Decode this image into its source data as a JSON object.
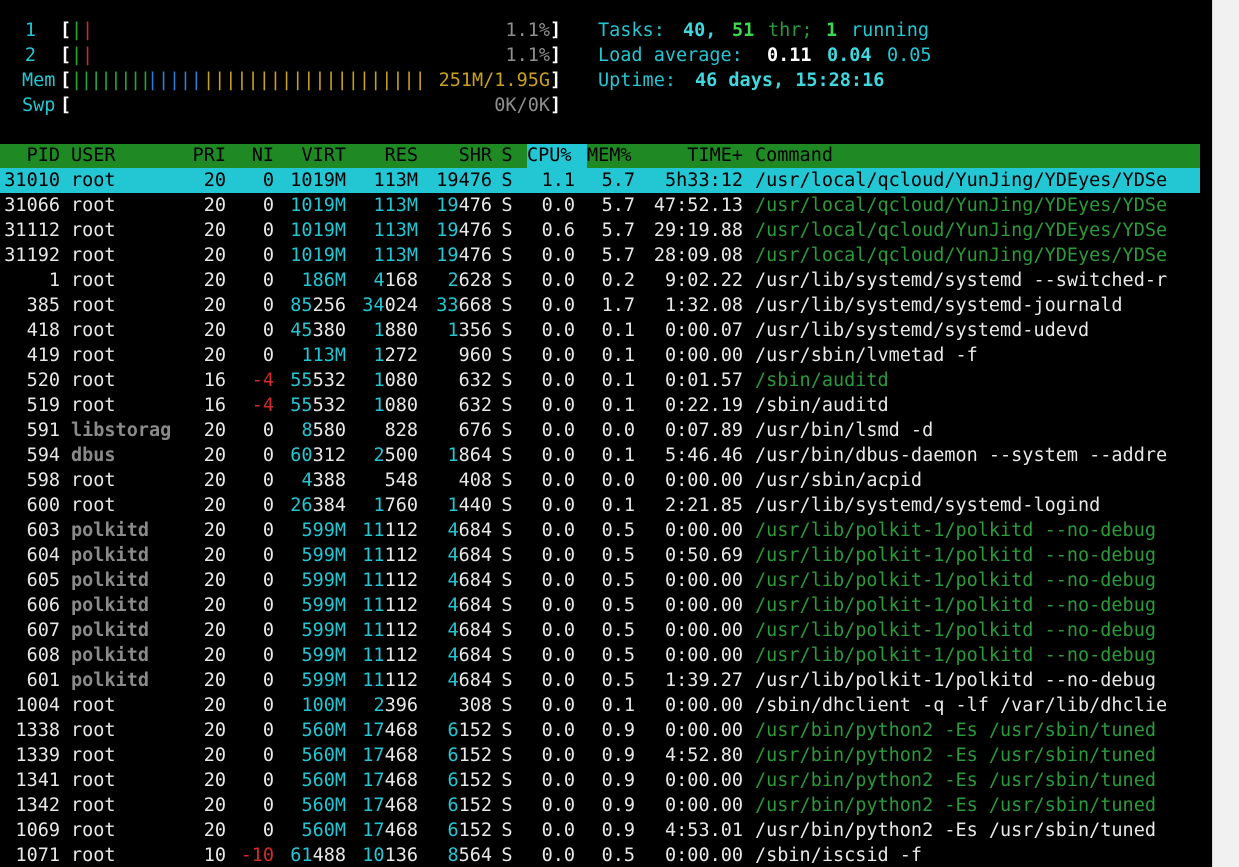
{
  "meters": {
    "cpu": [
      {
        "label": "1",
        "bar_green": "|",
        "bar_red": "|",
        "value": "1.1%"
      },
      {
        "label": "2",
        "bar_green": "|",
        "bar_red": "|",
        "value": "1.1%"
      }
    ],
    "mem": {
      "label": "Mem",
      "bar_green": "||||||||",
      "bar_blue": "|||||",
      "bar_yellow": "||||||||||||||||||||",
      "value": "251M/1.95G"
    },
    "swp": {
      "label": "Swp",
      "value": "0K/0K"
    },
    "bracket_open": "[",
    "bracket_close": "]"
  },
  "tasks": {
    "label": "Tasks:",
    "count": "40,",
    "threads": "51",
    "thr_label": "thr;",
    "running": "1",
    "running_label": "running"
  },
  "load": {
    "label": "Load average:",
    "one": "0.11",
    "five": "0.04",
    "fifteen": "0.05"
  },
  "uptime": {
    "label": "Uptime:",
    "value": "46 days, 15:28:16"
  },
  "columns": {
    "pid": "PID",
    "user": "USER",
    "pri": "PRI",
    "ni": "NI",
    "virt": "VIRT",
    "res": "RES",
    "shr": "SHR",
    "s": "S",
    "cpu": "CPU%",
    "mem": "MEM%",
    "time": "TIME+",
    "command": "Command"
  },
  "colors": {
    "header_bg": "#1f8a23",
    "sort_col_bg": "#23c6d3",
    "selected_row_bg": "#23c6d3",
    "thread_cmd": "#2b9a3a",
    "cyan": "#23c6d3"
  },
  "processes": [
    {
      "pid": "31010",
      "user": "root",
      "pri": "20",
      "ni": "0",
      "virt": "1019M",
      "res": "113M",
      "shr": "19476",
      "s": "S",
      "cpu": "1.1",
      "mem": "5.7",
      "time": "5h33:12",
      "command": "/usr/local/qcloud/YunJing/YDEyes/YDSe",
      "selected": true,
      "thread": false,
      "user_dim": false
    },
    {
      "pid": "31066",
      "user": "root",
      "pri": "20",
      "ni": "0",
      "virt": "1019M",
      "res": "113M",
      "shr": "19476",
      "s": "S",
      "cpu": "0.0",
      "mem": "5.7",
      "time": "47:52.13",
      "command": "/usr/local/qcloud/YunJing/YDEyes/YDSe",
      "selected": false,
      "thread": true,
      "user_dim": false
    },
    {
      "pid": "31112",
      "user": "root",
      "pri": "20",
      "ni": "0",
      "virt": "1019M",
      "res": "113M",
      "shr": "19476",
      "s": "S",
      "cpu": "0.6",
      "mem": "5.7",
      "time": "29:19.88",
      "command": "/usr/local/qcloud/YunJing/YDEyes/YDSe",
      "selected": false,
      "thread": true,
      "user_dim": false
    },
    {
      "pid": "31192",
      "user": "root",
      "pri": "20",
      "ni": "0",
      "virt": "1019M",
      "res": "113M",
      "shr": "19476",
      "s": "S",
      "cpu": "0.0",
      "mem": "5.7",
      "time": "28:09.08",
      "command": "/usr/local/qcloud/YunJing/YDEyes/YDSe",
      "selected": false,
      "thread": true,
      "user_dim": false
    },
    {
      "pid": "1",
      "user": "root",
      "pri": "20",
      "ni": "0",
      "virt": "186M",
      "res": "4168",
      "shr": "2628",
      "s": "S",
      "cpu": "0.0",
      "mem": "0.2",
      "time": "9:02.22",
      "command": "/usr/lib/systemd/systemd --switched-r",
      "selected": false,
      "thread": false,
      "user_dim": false
    },
    {
      "pid": "385",
      "user": "root",
      "pri": "20",
      "ni": "0",
      "virt": "85256",
      "res": "34024",
      "shr": "33668",
      "s": "S",
      "cpu": "0.0",
      "mem": "1.7",
      "time": "1:32.08",
      "command": "/usr/lib/systemd/systemd-journald",
      "selected": false,
      "thread": false,
      "user_dim": false
    },
    {
      "pid": "418",
      "user": "root",
      "pri": "20",
      "ni": "0",
      "virt": "45380",
      "res": "1880",
      "shr": "1356",
      "s": "S",
      "cpu": "0.0",
      "mem": "0.1",
      "time": "0:00.07",
      "command": "/usr/lib/systemd/systemd-udevd",
      "selected": false,
      "thread": false,
      "user_dim": false
    },
    {
      "pid": "419",
      "user": "root",
      "pri": "20",
      "ni": "0",
      "virt": "113M",
      "res": "1272",
      "shr": "960",
      "s": "S",
      "cpu": "0.0",
      "mem": "0.1",
      "time": "0:00.00",
      "command": "/usr/sbin/lvmetad -f",
      "selected": false,
      "thread": false,
      "user_dim": false
    },
    {
      "pid": "520",
      "user": "root",
      "pri": "16",
      "ni": "-4",
      "virt": "55532",
      "res": "1080",
      "shr": "632",
      "s": "S",
      "cpu": "0.0",
      "mem": "0.1",
      "time": "0:01.57",
      "command": "/sbin/auditd",
      "selected": false,
      "thread": true,
      "user_dim": false
    },
    {
      "pid": "519",
      "user": "root",
      "pri": "16",
      "ni": "-4",
      "virt": "55532",
      "res": "1080",
      "shr": "632",
      "s": "S",
      "cpu": "0.0",
      "mem": "0.1",
      "time": "0:22.19",
      "command": "/sbin/auditd",
      "selected": false,
      "thread": false,
      "user_dim": false
    },
    {
      "pid": "591",
      "user": "libstorag",
      "pri": "20",
      "ni": "0",
      "virt": "8580",
      "res": "828",
      "shr": "676",
      "s": "S",
      "cpu": "0.0",
      "mem": "0.0",
      "time": "0:07.89",
      "command": "/usr/bin/lsmd -d",
      "selected": false,
      "thread": false,
      "user_dim": true
    },
    {
      "pid": "594",
      "user": "dbus",
      "pri": "20",
      "ni": "0",
      "virt": "60312",
      "res": "2500",
      "shr": "1864",
      "s": "S",
      "cpu": "0.0",
      "mem": "0.1",
      "time": "5:46.46",
      "command": "/usr/bin/dbus-daemon --system --addre",
      "selected": false,
      "thread": false,
      "user_dim": true
    },
    {
      "pid": "598",
      "user": "root",
      "pri": "20",
      "ni": "0",
      "virt": "4388",
      "res": "548",
      "shr": "408",
      "s": "S",
      "cpu": "0.0",
      "mem": "0.0",
      "time": "0:00.00",
      "command": "/usr/sbin/acpid",
      "selected": false,
      "thread": false,
      "user_dim": false
    },
    {
      "pid": "600",
      "user": "root",
      "pri": "20",
      "ni": "0",
      "virt": "26384",
      "res": "1760",
      "shr": "1440",
      "s": "S",
      "cpu": "0.0",
      "mem": "0.1",
      "time": "2:21.85",
      "command": "/usr/lib/systemd/systemd-logind",
      "selected": false,
      "thread": false,
      "user_dim": false
    },
    {
      "pid": "603",
      "user": "polkitd",
      "pri": "20",
      "ni": "0",
      "virt": "599M",
      "res": "11112",
      "shr": "4684",
      "s": "S",
      "cpu": "0.0",
      "mem": "0.5",
      "time": "0:00.00",
      "command": "/usr/lib/polkit-1/polkitd --no-debug",
      "selected": false,
      "thread": true,
      "user_dim": true
    },
    {
      "pid": "604",
      "user": "polkitd",
      "pri": "20",
      "ni": "0",
      "virt": "599M",
      "res": "11112",
      "shr": "4684",
      "s": "S",
      "cpu": "0.0",
      "mem": "0.5",
      "time": "0:50.69",
      "command": "/usr/lib/polkit-1/polkitd --no-debug",
      "selected": false,
      "thread": true,
      "user_dim": true
    },
    {
      "pid": "605",
      "user": "polkitd",
      "pri": "20",
      "ni": "0",
      "virt": "599M",
      "res": "11112",
      "shr": "4684",
      "s": "S",
      "cpu": "0.0",
      "mem": "0.5",
      "time": "0:00.00",
      "command": "/usr/lib/polkit-1/polkitd --no-debug",
      "selected": false,
      "thread": true,
      "user_dim": true
    },
    {
      "pid": "606",
      "user": "polkitd",
      "pri": "20",
      "ni": "0",
      "virt": "599M",
      "res": "11112",
      "shr": "4684",
      "s": "S",
      "cpu": "0.0",
      "mem": "0.5",
      "time": "0:00.00",
      "command": "/usr/lib/polkit-1/polkitd --no-debug",
      "selected": false,
      "thread": true,
      "user_dim": true
    },
    {
      "pid": "607",
      "user": "polkitd",
      "pri": "20",
      "ni": "0",
      "virt": "599M",
      "res": "11112",
      "shr": "4684",
      "s": "S",
      "cpu": "0.0",
      "mem": "0.5",
      "time": "0:00.00",
      "command": "/usr/lib/polkit-1/polkitd --no-debug",
      "selected": false,
      "thread": true,
      "user_dim": true
    },
    {
      "pid": "608",
      "user": "polkitd",
      "pri": "20",
      "ni": "0",
      "virt": "599M",
      "res": "11112",
      "shr": "4684",
      "s": "S",
      "cpu": "0.0",
      "mem": "0.5",
      "time": "0:00.00",
      "command": "/usr/lib/polkit-1/polkitd --no-debug",
      "selected": false,
      "thread": true,
      "user_dim": true
    },
    {
      "pid": "601",
      "user": "polkitd",
      "pri": "20",
      "ni": "0",
      "virt": "599M",
      "res": "11112",
      "shr": "4684",
      "s": "S",
      "cpu": "0.0",
      "mem": "0.5",
      "time": "1:39.27",
      "command": "/usr/lib/polkit-1/polkitd --no-debug",
      "selected": false,
      "thread": false,
      "user_dim": true
    },
    {
      "pid": "1004",
      "user": "root",
      "pri": "20",
      "ni": "0",
      "virt": "100M",
      "res": "2396",
      "shr": "308",
      "s": "S",
      "cpu": "0.0",
      "mem": "0.1",
      "time": "0:00.00",
      "command": "/sbin/dhclient -q -lf /var/lib/dhclie",
      "selected": false,
      "thread": false,
      "user_dim": false
    },
    {
      "pid": "1338",
      "user": "root",
      "pri": "20",
      "ni": "0",
      "virt": "560M",
      "res": "17468",
      "shr": "6152",
      "s": "S",
      "cpu": "0.0",
      "mem": "0.9",
      "time": "0:00.00",
      "command": "/usr/bin/python2 -Es /usr/sbin/tuned",
      "selected": false,
      "thread": true,
      "user_dim": false
    },
    {
      "pid": "1339",
      "user": "root",
      "pri": "20",
      "ni": "0",
      "virt": "560M",
      "res": "17468",
      "shr": "6152",
      "s": "S",
      "cpu": "0.0",
      "mem": "0.9",
      "time": "4:52.80",
      "command": "/usr/bin/python2 -Es /usr/sbin/tuned",
      "selected": false,
      "thread": true,
      "user_dim": false
    },
    {
      "pid": "1341",
      "user": "root",
      "pri": "20",
      "ni": "0",
      "virt": "560M",
      "res": "17468",
      "shr": "6152",
      "s": "S",
      "cpu": "0.0",
      "mem": "0.9",
      "time": "0:00.00",
      "command": "/usr/bin/python2 -Es /usr/sbin/tuned",
      "selected": false,
      "thread": true,
      "user_dim": false
    },
    {
      "pid": "1342",
      "user": "root",
      "pri": "20",
      "ni": "0",
      "virt": "560M",
      "res": "17468",
      "shr": "6152",
      "s": "S",
      "cpu": "0.0",
      "mem": "0.9",
      "time": "0:00.00",
      "command": "/usr/bin/python2 -Es /usr/sbin/tuned",
      "selected": false,
      "thread": true,
      "user_dim": false
    },
    {
      "pid": "1069",
      "user": "root",
      "pri": "20",
      "ni": "0",
      "virt": "560M",
      "res": "17468",
      "shr": "6152",
      "s": "S",
      "cpu": "0.0",
      "mem": "0.9",
      "time": "4:53.01",
      "command": "/usr/bin/python2 -Es /usr/sbin/tuned",
      "selected": false,
      "thread": false,
      "user_dim": false
    },
    {
      "pid": "1071",
      "user": "root",
      "pri": "10",
      "ni": "-10",
      "virt": "61488",
      "res": "10136",
      "shr": "8564",
      "s": "S",
      "cpu": "0.0",
      "mem": "0.5",
      "time": "0:00.00",
      "command": "/sbin/iscsid -f",
      "selected": false,
      "thread": false,
      "user_dim": false
    }
  ]
}
